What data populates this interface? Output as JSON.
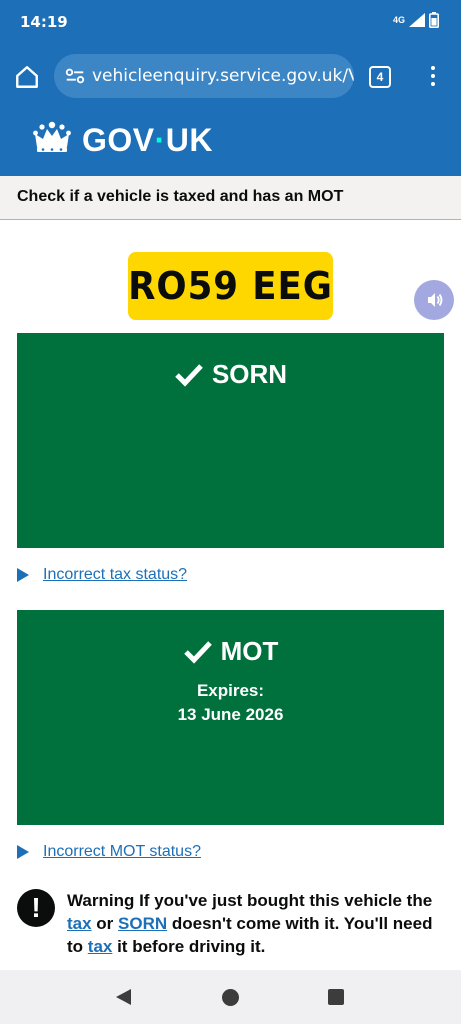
{
  "status_bar": {
    "time": "14:19",
    "network": "4G"
  },
  "browser": {
    "url": "vehicleenquiry.service.gov.uk/V",
    "tab_count": "4"
  },
  "header": {
    "brand_left": "GOV",
    "brand_dot": "·",
    "brand_right": "UK"
  },
  "service": {
    "title": "Check if a vehicle is taxed and has an MOT"
  },
  "vehicle": {
    "registration": "RO59 EEG"
  },
  "tax": {
    "status": "SORN",
    "details_link": "Incorrect tax status?"
  },
  "mot": {
    "status": "MOT",
    "expires_label": "Expires:",
    "expires_date": "13 June 2026",
    "details_link": "Incorrect MOT status?"
  },
  "warning": {
    "icon": "!",
    "part1": "Warning If you've just bought this vehicle the ",
    "link_tax": "tax",
    "part2": " or ",
    "link_sorn": "SORN",
    "part3": " doesn't come with it. You'll need to ",
    "link_tax2": "tax",
    "part4": " it before driving it."
  },
  "colors": {
    "govuk_blue": "#1d70b8",
    "success_green": "#00703c",
    "plate_yellow": "#ffd700",
    "crown_dot": "#00ffe0"
  },
  "icons": [
    "home-icon",
    "site-settings-icon",
    "tabs-icon",
    "more-icon",
    "crown-icon",
    "check-icon",
    "audio-icon",
    "warning-icon"
  ]
}
